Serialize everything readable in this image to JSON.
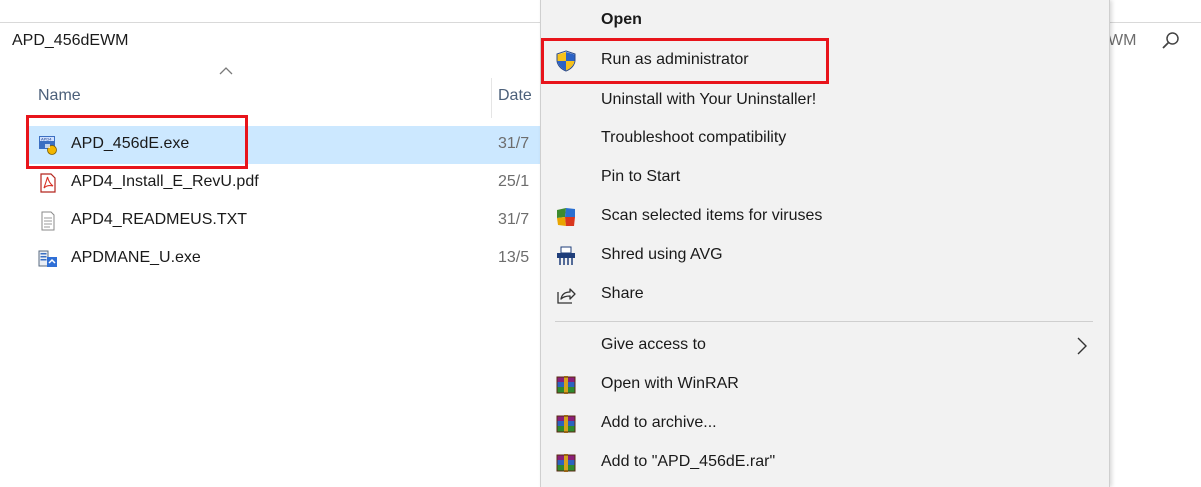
{
  "explorer": {
    "path": "APD_456dEWM",
    "search_tail": "WM",
    "columns": {
      "name": "Name",
      "date": "Date"
    },
    "files": [
      {
        "name": "APD_456dE.exe",
        "date": "31/7",
        "icon": "apd-exe-icon",
        "selected": true
      },
      {
        "name": "APD4_Install_E_RevU.pdf",
        "date": "25/1",
        "icon": "pdf-icon",
        "selected": false
      },
      {
        "name": "APD4_READMEUS.TXT",
        "date": "31/7",
        "icon": "text-file-icon",
        "selected": false
      },
      {
        "name": "APDMANE_U.exe",
        "date": "13/5",
        "icon": "setup-exe-icon",
        "selected": false
      }
    ]
  },
  "context_menu": {
    "items": [
      {
        "label": "Open",
        "icon": "",
        "bold": true
      },
      {
        "label": "Run as administrator",
        "icon": "uac-shield-icon"
      },
      {
        "label": "Uninstall with Your Uninstaller!",
        "icon": ""
      },
      {
        "label": "Troubleshoot compatibility",
        "icon": ""
      },
      {
        "label": "Pin to Start",
        "icon": ""
      },
      {
        "label": "Scan selected items for viruses",
        "icon": "avg-icon"
      },
      {
        "label": "Shred using AVG",
        "icon": "shredder-icon"
      },
      {
        "label": "Share",
        "icon": "share-icon"
      },
      {
        "label": "Give access to",
        "icon": "",
        "submenu": true
      },
      {
        "label": "Open with WinRAR",
        "icon": "winrar-icon"
      },
      {
        "label": "Add to archive...",
        "icon": "winrar-icon"
      },
      {
        "label": "Add to \"APD_456dE.rar\"",
        "icon": "winrar-icon"
      }
    ]
  },
  "colors": {
    "highlight_box": "#e8141b",
    "selection": "#cce8ff",
    "menu_bg": "#f2f2f2"
  }
}
